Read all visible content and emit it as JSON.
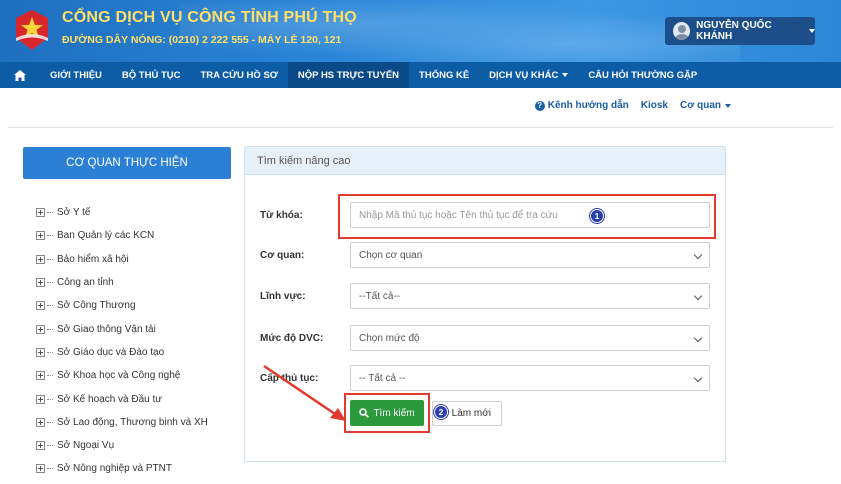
{
  "header": {
    "title": "CỔNG DỊCH VỤ CÔNG TỈNH PHÚ THỌ",
    "hotline": "ĐƯỜNG DÂY NÓNG: (0210) 2 222 555 - MÁY LẺ 120, 121",
    "user_name": "NGUYỄN QUỐC KHÁNH"
  },
  "nav": {
    "items": [
      {
        "label": "GIỚI THIỆU"
      },
      {
        "label": "BỘ THỦ TỤC"
      },
      {
        "label": "TRA CỨU HỒ SƠ"
      },
      {
        "label": "NỘP HS TRỰC TUYẾN"
      },
      {
        "label": "THỐNG KÊ"
      },
      {
        "label": "DỊCH VỤ KHÁC"
      },
      {
        "label": "CÂU HỎI THƯỜNG GẶP"
      }
    ],
    "active_index": 3
  },
  "sublinks": {
    "guide": "Kênh hướng dẫn",
    "kiosk": "Kiosk",
    "agency": "Cơ quan"
  },
  "sidebar": {
    "title": "CƠ QUAN THỰC HIỆN",
    "items": [
      "Sở Y tế",
      "Ban Quản lý các KCN",
      "Bảo hiểm xã hội",
      "Công an tỉnh",
      "Sở Công Thương",
      "Sở Giao thông Vận tải",
      "Sở Giáo dục và Đào tạo",
      "Sở Khoa học và Công nghệ",
      "Sở Kế hoạch và Đầu tư",
      "Sở Lao động, Thương binh và XH",
      "Sở Ngoại Vụ",
      "Sở Nông nghiệp và PTNT"
    ]
  },
  "search": {
    "title": "Tìm kiếm nâng cao",
    "keyword_label": "Từ khóa:",
    "keyword_placeholder": "Nhập Mã thủ tục hoặc Tên thủ tục để tra cứu",
    "agency_label": "Cơ quan:",
    "agency_value": "Chọn cơ quan",
    "field_label": "Lĩnh vực:",
    "field_value": "--Tất cả--",
    "level_label": "Mức độ DVC:",
    "level_value": "Chọn mức độ",
    "grade_label": "Cấp thủ tục:",
    "grade_value": "-- Tất cả --",
    "search_button": "Tìm kiếm",
    "reset_button": "Làm mới",
    "step1": "1",
    "step2": "2"
  },
  "colors": {
    "header_blue": "#2a86d8",
    "nav_blue": "#0d5ca6",
    "title_yellow": "#ffe066",
    "search_green": "#2c9a3c",
    "highlight_red": "#e23a2c"
  }
}
